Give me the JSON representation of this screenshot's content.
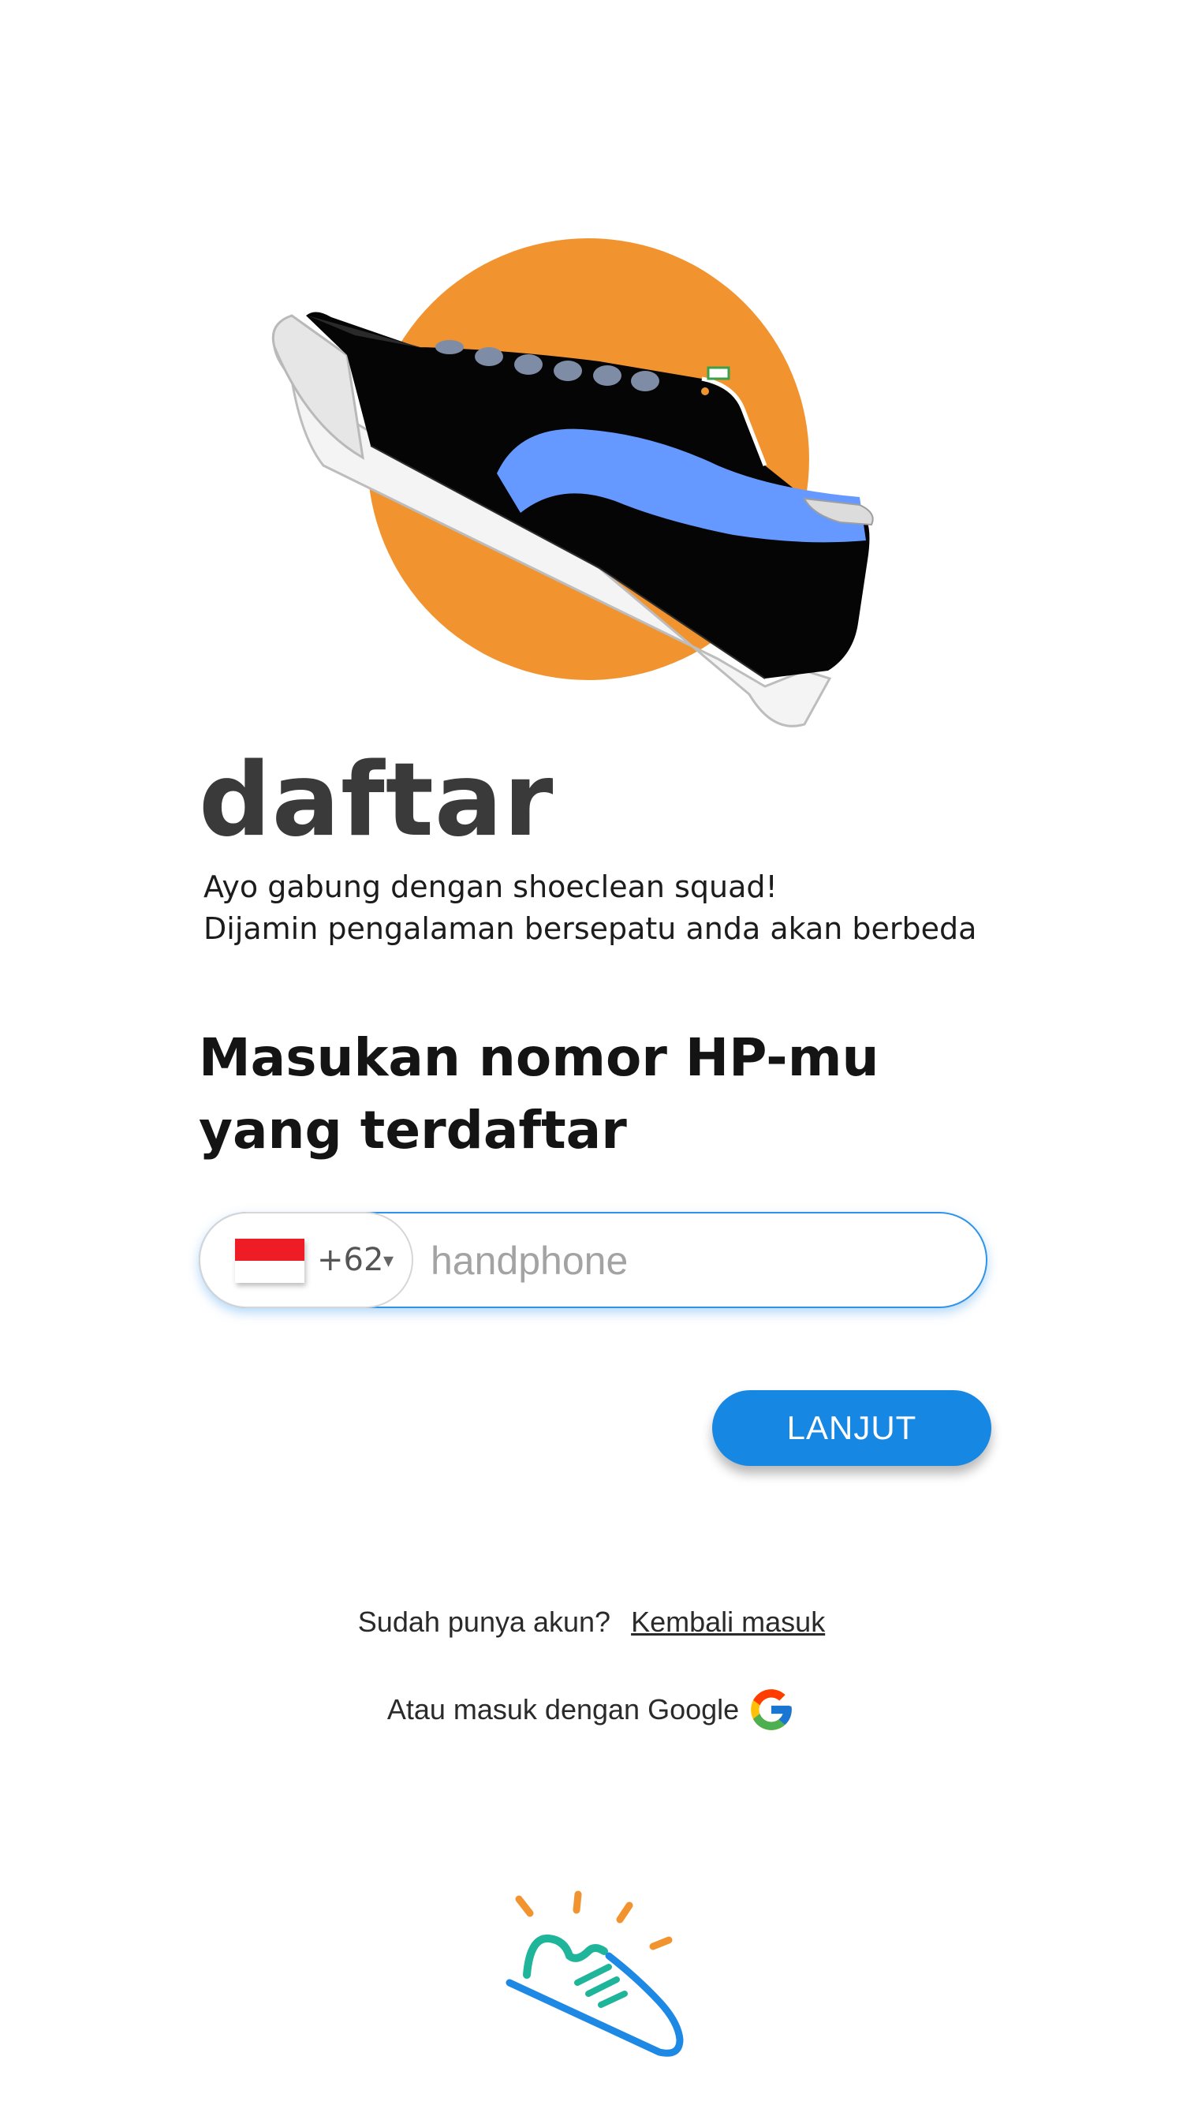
{
  "screen": {
    "title": "daftar",
    "subtitle_lines": [
      "Ayo gabung dengan shoeclean squad!",
      "Dijamin pengalaman bersepatu anda akan berbeda"
    ]
  },
  "hero": {
    "icon": "sneaker-illustration",
    "circle_color": "#f19430",
    "stripe_color": "#6699ff"
  },
  "form": {
    "prompt_lines": [
      "Masukan nomor HP-mu",
      "yang terdaftar"
    ],
    "country": {
      "flag": "indonesia-flag-icon",
      "dial_code": "+62",
      "caret": "▾"
    },
    "phone": {
      "value": "",
      "placeholder": "handphone"
    },
    "submit_label": "LANJUT",
    "accent_color": "#1787e4"
  },
  "footer": {
    "have_account_text": "Sudah punya akun?",
    "login_link": "Kembali masuk",
    "google_text": "Atau masuk dengan Google",
    "google_icon": "google-g-icon",
    "logo_icon": "shoeclean-logo-icon"
  }
}
